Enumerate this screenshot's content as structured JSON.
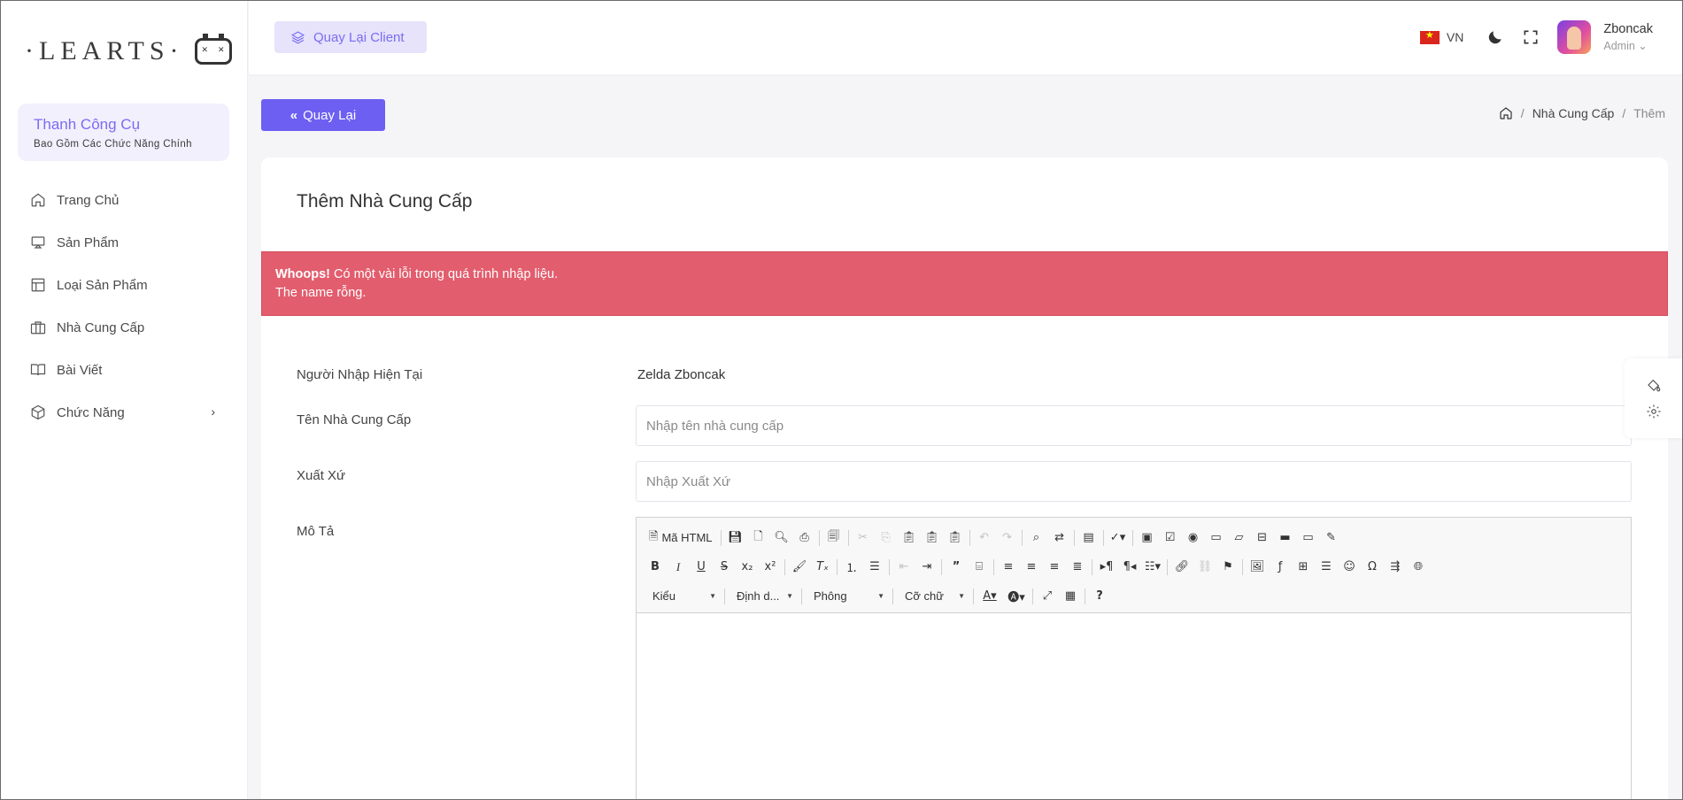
{
  "sidebar": {
    "logo": "·LEARTS·",
    "toolbox": {
      "title": "Thanh Công Cụ",
      "subtitle": "Bao Gồm Các Chức Năng Chính"
    },
    "items": [
      {
        "label": "Trang Chủ",
        "icon": "home-icon"
      },
      {
        "label": "Sản Phẩm",
        "icon": "monitor-icon"
      },
      {
        "label": "Loại Sản Phẩm",
        "icon": "layout-icon"
      },
      {
        "label": "Nhà Cung Cấp",
        "icon": "briefcase-icon"
      },
      {
        "label": "Bài Viết",
        "icon": "book-icon"
      },
      {
        "label": "Chức Năng",
        "icon": "box-icon"
      }
    ]
  },
  "header": {
    "client_button": "Quay Lại Client",
    "language": "VN",
    "user": {
      "name": "Zboncak",
      "role": "Admin"
    }
  },
  "page": {
    "back_button": "Quay Lại",
    "breadcrumb": {
      "parent": "Nhà Cung Cấp",
      "current": "Thêm"
    },
    "title": "Thêm Nhà Cung Cấp"
  },
  "alert": {
    "strong": "Whoops!",
    "message": "Có một vài lỗi trong quá trình nhập liệu.",
    "detail": "The name rỗng."
  },
  "form": {
    "current_user_label": "Người Nhập Hiện Tại",
    "current_user_value": "Zelda Zboncak",
    "name_label": "Tên Nhà Cung Cấp",
    "name_placeholder": "Nhập tên nhà cung cấp",
    "origin_label": "Xuất Xứ",
    "origin_placeholder": "Nhập Xuất Xứ",
    "description_label": "Mô Tả"
  },
  "editor": {
    "source_label": "Mã HTML",
    "styles_combo": "Kiểu",
    "format_combo": "Định d...",
    "font_combo": "Phông",
    "size_combo": "Cỡ chữ"
  },
  "colors": {
    "accent": "#6d5ff2",
    "alert": "#e25d6d",
    "client_btn_bg": "#e6e3fb"
  }
}
